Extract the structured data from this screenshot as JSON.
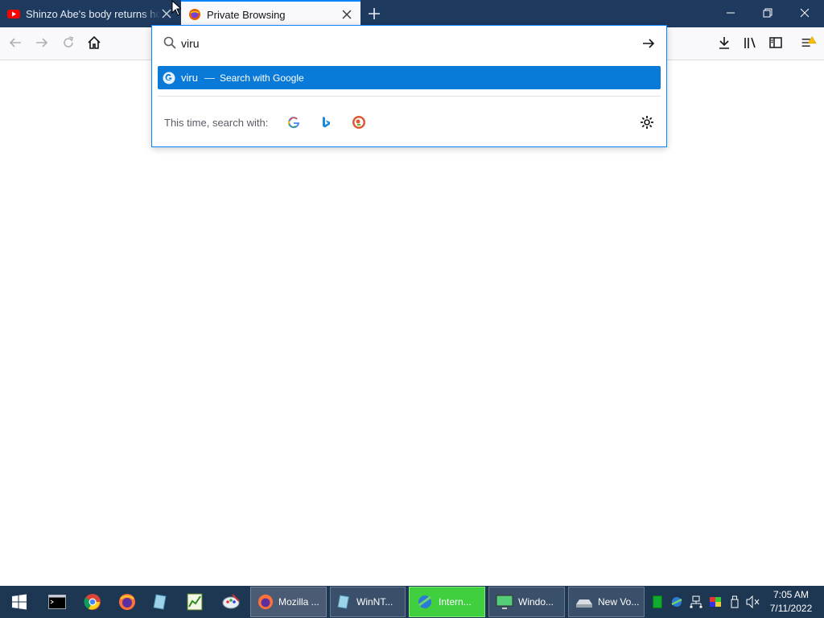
{
  "tabs": [
    {
      "title": "Shinzo Abe's body returns home",
      "favicon": "youtube-icon",
      "active": false
    },
    {
      "title": "Private Browsing",
      "favicon": "firefox-private-icon",
      "active": true
    }
  ],
  "urlbar": {
    "value": "viru",
    "suggestion": {
      "query": "viru",
      "separator": "—",
      "action": "Search with Google"
    },
    "oneoff_label": "This time, search with:",
    "engines": [
      "google-icon",
      "bing-icon",
      "duckduckgo-icon"
    ]
  },
  "taskbar": {
    "tasks": [
      {
        "label": "Mozilla ..."
      },
      {
        "label": "WinNT..."
      },
      {
        "label": "Intern..."
      },
      {
        "label": "Windo..."
      },
      {
        "label": "New Vo..."
      }
    ],
    "clock": {
      "time": "7:05 AM",
      "date": "7/11/2022"
    }
  },
  "colors": {
    "accent": "#0a84ff",
    "suggest_bg": "#0a7ad8",
    "tabstrip": "#1f3a5f",
    "taskbar": "#1d3652"
  }
}
